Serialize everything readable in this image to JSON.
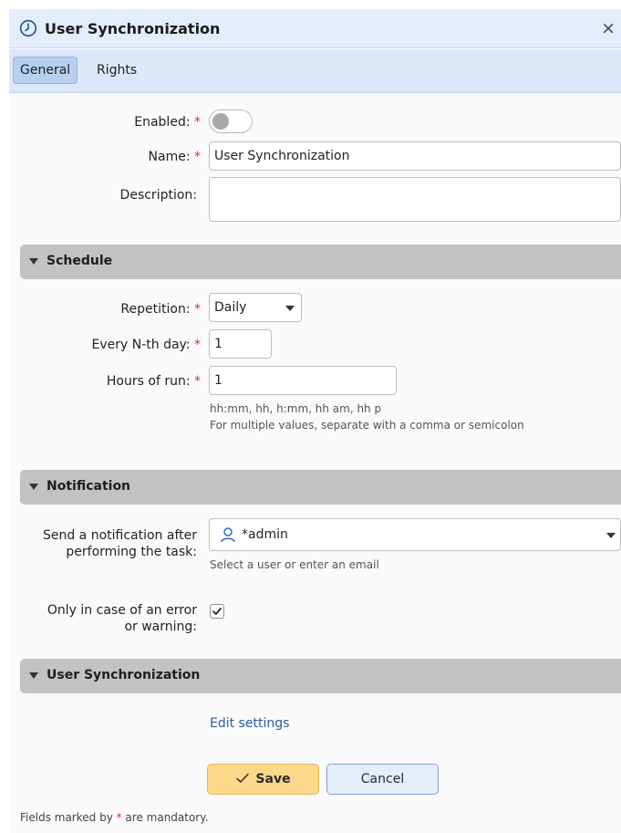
{
  "window": {
    "title": "User Synchronization",
    "close_symbol": "×",
    "icon": "clock-icon"
  },
  "tabs": [
    {
      "label": "General",
      "active": true
    },
    {
      "label": "Rights",
      "active": false
    }
  ],
  "general": {
    "enabled_label": "Enabled:",
    "enabled_value": false,
    "name_label": "Name:",
    "name_value": "User Synchronization",
    "description_label": "Description:",
    "description_value": ""
  },
  "schedule": {
    "section_title": "Schedule",
    "repetition_label": "Repetition:",
    "repetition_value": "Daily",
    "every_nth_day_label": "Every N-th day:",
    "every_nth_day_value": "1",
    "hours_label": "Hours of run:",
    "hours_value": "1",
    "hint_formats": "hh:mm, hh, h:mm, hh am, hh p",
    "hint_multiple": "For multiple values, separate with a comma or semicolon"
  },
  "notification": {
    "section_title": "Notification",
    "send_label_line1": "Send a notification after",
    "send_label_line2": "performing the task:",
    "recipient_value": "*admin",
    "recipient_hint": "Select a user or enter an email",
    "error_label_line1": "Only in case of an error",
    "error_label_line2": "or warning:",
    "error_checked": true
  },
  "user_sync": {
    "section_title": "User Synchronization",
    "edit_link": "Edit settings"
  },
  "buttons": {
    "save_label": "Save",
    "cancel_label": "Cancel"
  },
  "footer": {
    "prefix": "Fields marked by ",
    "asterisk": "*",
    "suffix": " are mandatory."
  },
  "required_mark": "*",
  "colors": {
    "titlebar_bg": "#e3edfb",
    "section_bg": "#c2c2c2",
    "required": "#d2322d",
    "link": "#2a5caa",
    "save_button": "#fcd88a",
    "cancel_button": "#e4eefb"
  }
}
